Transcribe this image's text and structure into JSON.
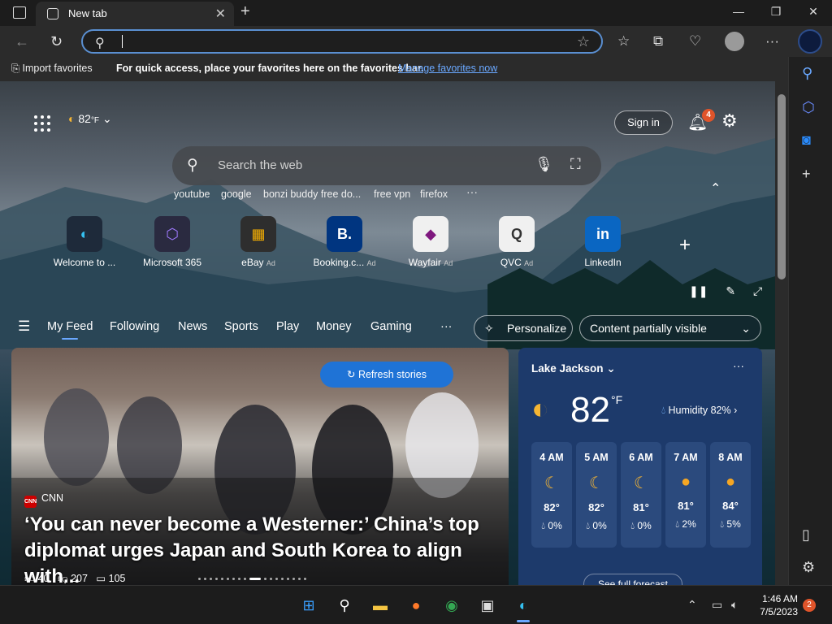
{
  "tab": {
    "title": "New tab",
    "close": "✕",
    "new": "+"
  },
  "window": {
    "minimize": "—",
    "maximize": "❐",
    "close": "✕"
  },
  "address": {
    "value": "",
    "placeholder": ""
  },
  "favorites_bar": {
    "import_label": "Import favorites",
    "hint": "For quick access, place your favorites here on the favorites bar.",
    "manage_link": "Manage favorites now"
  },
  "header": {
    "weather_temp": "82",
    "weather_unit": "°F",
    "sign_in": "Sign in",
    "notification_count": "4"
  },
  "search": {
    "placeholder": "Search the web",
    "recent": [
      "youtube",
      "google",
      "bonzi buddy free do...",
      "free vpn",
      "firefox"
    ],
    "more": "···"
  },
  "shortcuts": [
    {
      "label": "Welcome to ...",
      "ad": "",
      "glyph": "◐",
      "bg": "#1e2a3a",
      "color": "#35c0f0"
    },
    {
      "label": "Microsoft 365",
      "ad": "",
      "glyph": "⬡",
      "bg": "#2a2a40",
      "color": "#a07aff"
    },
    {
      "label": "eBay",
      "ad": "Ad",
      "glyph": "▦",
      "bg": "#2e2e2e",
      "color": "#f5af02"
    },
    {
      "label": "Booking.c...",
      "ad": "Ad",
      "glyph": "B.",
      "bg": "#003580",
      "color": "#ffffff"
    },
    {
      "label": "Wayfair",
      "ad": "Ad",
      "glyph": "◆",
      "bg": "#f0f0f0",
      "color": "#7f187f"
    },
    {
      "label": "QVC",
      "ad": "Ad",
      "glyph": "Q",
      "bg": "#f0f0f0",
      "color": "#333333"
    },
    {
      "label": "LinkedIn",
      "ad": "",
      "glyph": "in",
      "bg": "#0a66c2",
      "color": "#ffffff"
    }
  ],
  "feed_nav": {
    "tabs": [
      "My Feed",
      "Following",
      "News",
      "Sports",
      "Play",
      "Money",
      "Gaming"
    ],
    "more": "···",
    "personalize": "Personalize",
    "visibility": "Content partially visible"
  },
  "news": {
    "refresh": "Refresh stories",
    "source": "CNN",
    "source_logo": "CNN",
    "headline": "‘You can never become a Westerner:’ China’s top diplomat urges Japan and South Korea to align with...",
    "likes": "40",
    "dislikes": "207",
    "comments": "105"
  },
  "weather": {
    "location": "Lake Jackson",
    "temp": "82",
    "unit": "°F",
    "humidity": "Humidity 82%",
    "more": "···",
    "hours": [
      {
        "time": "4 AM",
        "icon": "moon",
        "temp": "82°",
        "precip": "0%"
      },
      {
        "time": "5 AM",
        "icon": "moon",
        "temp": "82°",
        "precip": "0%"
      },
      {
        "time": "6 AM",
        "icon": "moon",
        "temp": "81°",
        "precip": "0%"
      },
      {
        "time": "7 AM",
        "icon": "sun",
        "temp": "81°",
        "precip": "2%"
      },
      {
        "time": "8 AM",
        "icon": "sun",
        "temp": "84°",
        "precip": "5%"
      }
    ],
    "full_forecast": "See full forecast"
  },
  "taskbar": {
    "time": "1:46 AM",
    "date": "7/5/2023",
    "notifications": "2"
  },
  "colors": {
    "accent": "#6aa8ff",
    "badge": "#e0542a",
    "refresh": "#1f73d6",
    "weather_card": "#1d3a6b"
  }
}
